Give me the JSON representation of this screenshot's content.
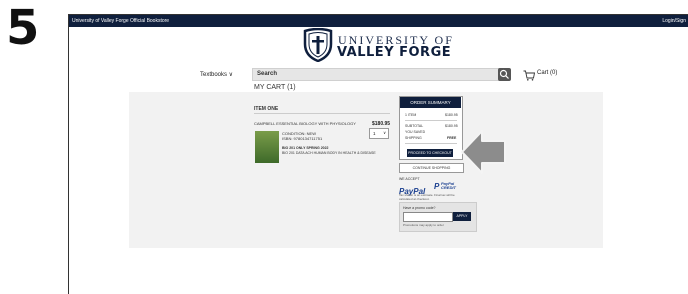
{
  "step_number": "5",
  "topbar": {
    "left_text": "University of Valley Forge Official Bookstore",
    "right_text": "Login/Sign"
  },
  "logo": {
    "line1": "UNIVERSITY OF",
    "line2": "VALLEY FORGE"
  },
  "nav": {
    "textbooks_label": "Textbooks ∨",
    "search_label": "Search",
    "cart_label": "Cart (0)"
  },
  "cart": {
    "heading": "MY CART (1)",
    "item_heading": "ITEM ONE",
    "item": {
      "title": "CAMPBELL ESSENTIAL BIOLOGY WITH PHYSIOLOGY",
      "price": "$180.95",
      "quantity": "1",
      "condition": "CONDITION: NEW",
      "isbn": "ISBN: 9780134711751",
      "course_line1": "BIO 201 ONLY SPRING 2022",
      "course_line2": "BIO 201 DATA ACH HUMAN BODY IN HEALTH & DISEASE"
    }
  },
  "order_summary": {
    "title": "ORDER SUMMARY",
    "rows": [
      {
        "label": "1 ITEM",
        "value": "$180.95"
      },
      {
        "label": "SUBTOTAL",
        "value": "$180.95"
      },
      {
        "label": "YOU SAVED",
        "value": ""
      },
      {
        "label": "SHIPPING",
        "value": "FREE"
      }
    ],
    "checkout_button": "PROCEED TO CHECKOUT",
    "continue_button": "CONTINUE SHOPPING"
  },
  "payment": {
    "we_accept": "WE ACCEPT",
    "paypal": "PayPal",
    "paypal_credit_line1": "PayPal",
    "paypal_credit_line2": "CREDIT",
    "fineprint": "Tax shown is an estimate. Final tax will be calculated at checkout."
  },
  "promo": {
    "label": "Have a promo code?",
    "apply_button": "APPLY",
    "note": "Promotions may apply to order"
  },
  "colors": {
    "navy": "#0f1f3d",
    "arrow": "#8c8c8c"
  }
}
